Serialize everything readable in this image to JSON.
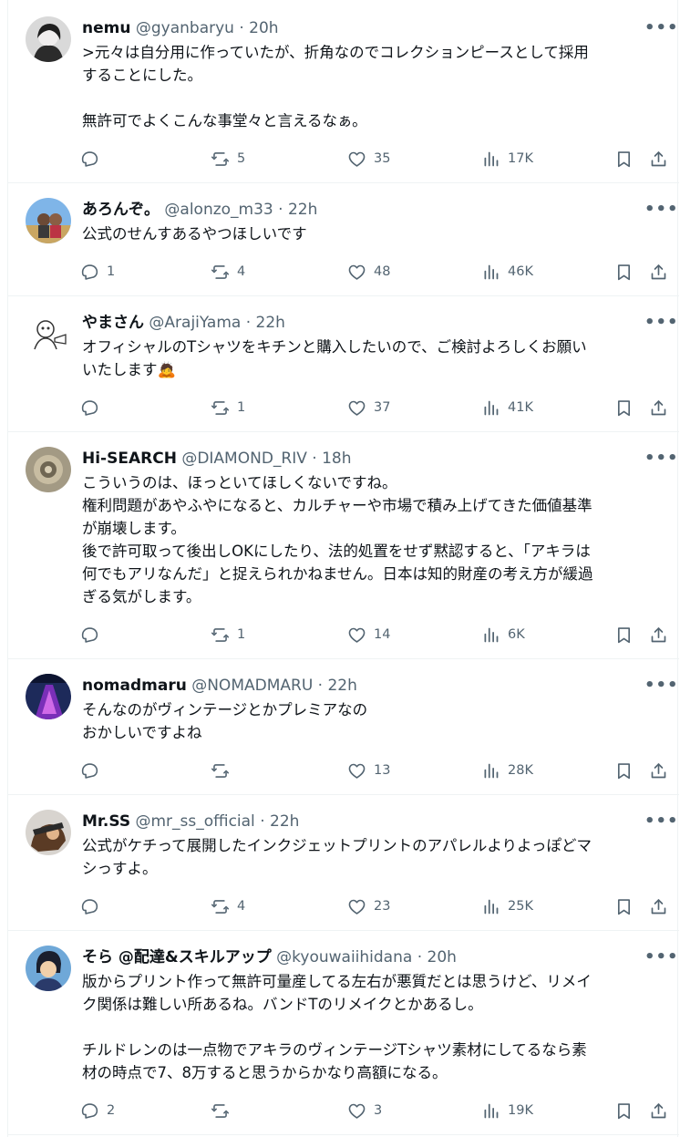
{
  "tweets": [
    {
      "display_name": "nemu",
      "handle": "@gyanbaryu",
      "time": "20h",
      "text": ">元々は自分用に作っていたが、折角なのでコレクションピースとして採用\nすることにした。\n\n無許可でよくこんな事堂々と言えるなぁ。",
      "replies": "",
      "reposts": "5",
      "likes": "35",
      "views": "17K"
    },
    {
      "display_name": "あろんぞ。",
      "handle": "@alonzo_m33",
      "time": "22h",
      "text": "公式のせんすあるやつほしいです",
      "replies": "1",
      "reposts": "4",
      "likes": "48",
      "views": "46K"
    },
    {
      "display_name": "やまさん",
      "handle": "@ArajiYama",
      "time": "22h",
      "text": "オフィシャルのTシャツをキチンと購入したいので、ご検討よろしくお願い\nいたします🙇",
      "replies": "",
      "reposts": "1",
      "likes": "37",
      "views": "41K"
    },
    {
      "display_name": "Hi-SEARCH",
      "handle": "@DIAMOND_RIV",
      "time": "18h",
      "text": "こういうのは、ほっといてほしくないですね。\n権利問題があやふやになると、カルチャーや市場で積み上げてきた価値基準\nが崩壊します。\n後で許可取って後出しOKにしたり、法的処置をせず黙認すると、「アキラは\n何でもアリなんだ」と捉えられかねません。日本は知的財産の考え方が緩過\nぎる気がします。",
      "replies": "",
      "reposts": "1",
      "likes": "14",
      "views": "6K"
    },
    {
      "display_name": "nomadmaru",
      "handle": "@NOMADMARU",
      "time": "22h",
      "text": "そんなのがヴィンテージとかプレミアなの\nおかしいですよね",
      "replies": "",
      "reposts": "",
      "likes": "13",
      "views": "28K"
    },
    {
      "display_name": "Mr.SS",
      "handle": "@mr_ss_official",
      "time": "22h",
      "text": "公式がケチって展開したインクジェットプリントのアパレルよりよっぽどマ\nシっすよ。",
      "replies": "",
      "reposts": "4",
      "likes": "23",
      "views": "25K"
    },
    {
      "display_name": "そら @配達&スキルアップ",
      "handle": "@kyouwaiihidana",
      "time": "20h",
      "text": "版からプリント作って無許可量産してる左右が悪質だとは思うけど、リメイ\nク関係は難しい所あるね。バンドTのリメイクとかあるし。\n\nチルドレンのは一点物でアキラのヴィンテージTシャツ素材にしてるなら素\n材の時点で7、8万すると思うからかなり高額になる。",
      "replies": "2",
      "reposts": "",
      "likes": "3",
      "views": "19K"
    }
  ],
  "ui": {
    "separator": "·",
    "more_glyph": "•••"
  },
  "colors": {
    "text": "#0f1419",
    "secondary": "#536471",
    "border": "#eff3f4"
  },
  "icons": [
    "more-icon",
    "reply-icon",
    "repost-icon",
    "like-icon",
    "views-icon",
    "bookmark-icon",
    "share-icon"
  ]
}
